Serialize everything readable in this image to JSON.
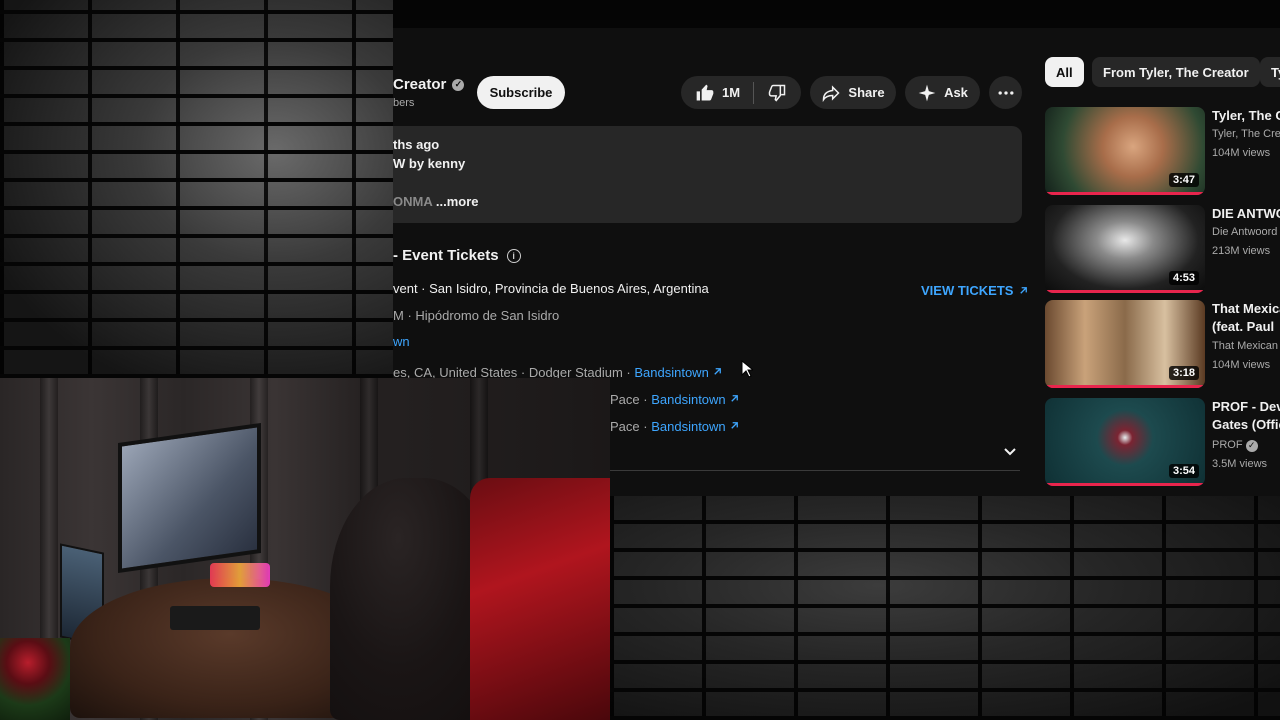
{
  "channel": {
    "name_fragment": "Creator",
    "subscribers_fragment": "bers",
    "subscribe_label": "Subscribe"
  },
  "actions": {
    "like_count": "1M",
    "share_label": "Share",
    "ask_label": "Ask"
  },
  "description": {
    "line1": "ths ago",
    "line2": "W by kenny",
    "line3_faded": "ONMA",
    "more_label": "...more"
  },
  "events": {
    "title": "- Event Tickets",
    "primary_location": "vent · San Isidro, Provincia de Buenos Aires, Argentina",
    "primary_venue": "M · Hipódromo de San Isidro",
    "primary_link_fragment": "wn",
    "view_tickets_label": "VIEW TICKETS",
    "row2_text": "es, CA, United States · Dodger Stadium",
    "row2_link": "Bandsintown",
    "row3_text": "Pace",
    "row3_link": "Bandsintown",
    "row4_text": "Pace",
    "row4_link": "Bandsintown"
  },
  "chips": [
    "All",
    "From Tyler, The Creator",
    "Ty"
  ],
  "recommendations": [
    {
      "title": "Tyler, The C",
      "channel": "Tyler, The Cre",
      "views": "104M views",
      "duration": "3:47"
    },
    {
      "title": "DIE ANTWO",
      "channel": "Die Antwoord",
      "views": "213M views",
      "duration": "4:53"
    },
    {
      "title": "That Mexica (feat. Paul W",
      "channel": "That Mexican",
      "views": "104M views",
      "duration": "3:18"
    },
    {
      "title": "PROF - Dev Gates (Offic",
      "channel": "PROF",
      "views": "3.5M views",
      "duration": "3:54"
    }
  ],
  "colors": {
    "link": "#3ea6ff",
    "progress": "#e8254d",
    "surface": "#272727",
    "background": "#0f0f0f"
  }
}
